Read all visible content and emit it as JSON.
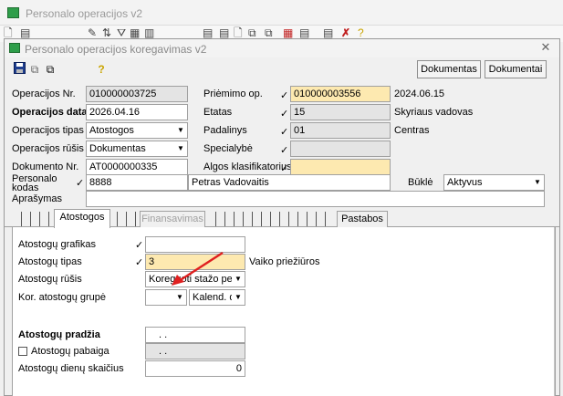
{
  "outer_window": {
    "title": "Personalo operacijos v2"
  },
  "dialog": {
    "title": "Personalo operacijos koregavimas v2",
    "close_glyph": "✕",
    "buttons": {
      "dokumentas": "Dokumentas",
      "dokumentai": "Dokumentai"
    }
  },
  "form": {
    "operacijos_nr": {
      "label": "Operacijos Nr.",
      "value": "010000003725"
    },
    "operacijos_data": {
      "label": "Operacijos data",
      "value": "2026.04.16"
    },
    "operacijos_tipas": {
      "label": "Operacijos tipas",
      "value": "Atostogos"
    },
    "operacijos_rusis": {
      "label": "Operacijos rūšis",
      "value": "Dokumentas"
    },
    "dokumento_nr": {
      "label": "Dokumento Nr.",
      "value": "AT0000000335"
    },
    "personalo_kodas": {
      "label_line1": "Personalo",
      "label_line2": "kodas",
      "value": "8888",
      "name": "Petras Vadovaitis"
    },
    "aprasymas": {
      "label": "Aprašymas",
      "value": ""
    },
    "priemimo_op": {
      "label": "Priėmimo op.",
      "value": "010000003556",
      "date": "2024.06.15"
    },
    "etatas": {
      "label": "Etatas",
      "value": "15",
      "description": "Skyriaus vadovas"
    },
    "padalinys": {
      "label": "Padalinys",
      "value": "01",
      "description": "Centras"
    },
    "specialybe": {
      "label": "Specialybė",
      "value": ""
    },
    "algos_klasifikatorius": {
      "label": "Algos klasifikatorius",
      "value": ""
    },
    "bukle": {
      "label": "Būklė",
      "value": "Aktyvus"
    },
    "check_mark": "✓"
  },
  "tabs": {
    "atostogos": "Atostogos",
    "finansavimas": "Finansavimas",
    "pastabos": "Pastabos"
  },
  "panel": {
    "atostogu_grafikas": {
      "label": "Atostogų grafikas",
      "value": ""
    },
    "atostogu_tipas": {
      "label": "Atostogų tipas",
      "value": "3",
      "description": "Vaiko priežiūros"
    },
    "atostogu_rusis": {
      "label": "Atostogų rūšis",
      "value": "Koreguoti stažo perio"
    },
    "kor_atostogu_grupe": {
      "label": "Kor. atostogų grupė",
      "value": "",
      "second_value": "Kalend. d."
    },
    "atostogu_pradzia": {
      "label": "Atostogų pradžia",
      "value": ". ."
    },
    "atostogu_pabaiga": {
      "label": "Atostogų pabaiga",
      "value": ". .",
      "checked": false
    },
    "atostogu_dienu_skaicius": {
      "label": "Atostogų dienų skaičius",
      "value": "0"
    }
  },
  "colors": {
    "highlight_field": "#fde9b0",
    "annotation_arrow": "#e02020",
    "app_icon": "#2e9e4a"
  }
}
